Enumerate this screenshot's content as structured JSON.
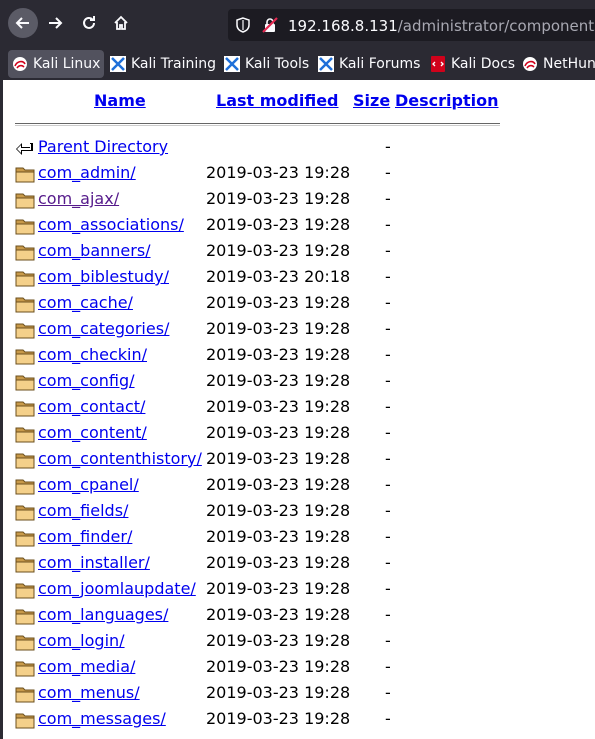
{
  "browser": {
    "url_host": "192.168.8.131",
    "url_path": "/administrator/components/",
    "bookmarks": [
      {
        "label": "Kali Linux",
        "icon": "kali-dragon-icon"
      },
      {
        "label": "Kali Training",
        "icon": "kali-training-icon"
      },
      {
        "label": "Kali Tools",
        "icon": "kali-tools-icon"
      },
      {
        "label": "Kali Forums",
        "icon": "kali-forums-icon"
      },
      {
        "label": "Kali Docs",
        "icon": "kali-docs-icon"
      },
      {
        "label": "NetHunter",
        "icon": "nethunter-icon"
      }
    ]
  },
  "listing": {
    "headers": {
      "name": "Name",
      "modified": "Last modified",
      "size": "Size",
      "description": "Description"
    },
    "parent": {
      "label": "Parent Directory",
      "size": "-"
    },
    "rows": [
      {
        "name": "com_admin/",
        "modified": "2019-03-23 19:28",
        "size": "-"
      },
      {
        "name": "com_ajax/",
        "modified": "2019-03-23 19:28",
        "size": "-"
      },
      {
        "name": "com_associations/",
        "modified": "2019-03-23 19:28",
        "size": "-"
      },
      {
        "name": "com_banners/",
        "modified": "2019-03-23 19:28",
        "size": "-"
      },
      {
        "name": "com_biblestudy/",
        "modified": "2019-03-23 20:18",
        "size": "-"
      },
      {
        "name": "com_cache/",
        "modified": "2019-03-23 19:28",
        "size": "-"
      },
      {
        "name": "com_categories/",
        "modified": "2019-03-23 19:28",
        "size": "-"
      },
      {
        "name": "com_checkin/",
        "modified": "2019-03-23 19:28",
        "size": "-"
      },
      {
        "name": "com_config/",
        "modified": "2019-03-23 19:28",
        "size": "-"
      },
      {
        "name": "com_contact/",
        "modified": "2019-03-23 19:28",
        "size": "-"
      },
      {
        "name": "com_content/",
        "modified": "2019-03-23 19:28",
        "size": "-"
      },
      {
        "name": "com_contenthistory/",
        "modified": "2019-03-23 19:28",
        "size": "-"
      },
      {
        "name": "com_cpanel/",
        "modified": "2019-03-23 19:28",
        "size": "-"
      },
      {
        "name": "com_fields/",
        "modified": "2019-03-23 19:28",
        "size": "-"
      },
      {
        "name": "com_finder/",
        "modified": "2019-03-23 19:28",
        "size": "-"
      },
      {
        "name": "com_installer/",
        "modified": "2019-03-23 19:28",
        "size": "-"
      },
      {
        "name": "com_joomlaupdate/",
        "modified": "2019-03-23 19:28",
        "size": "-"
      },
      {
        "name": "com_languages/",
        "modified": "2019-03-23 19:28",
        "size": "-"
      },
      {
        "name": "com_login/",
        "modified": "2019-03-23 19:28",
        "size": "-"
      },
      {
        "name": "com_media/",
        "modified": "2019-03-23 19:28",
        "size": "-"
      },
      {
        "name": "com_menus/",
        "modified": "2019-03-23 19:28",
        "size": "-"
      },
      {
        "name": "com_messages/",
        "modified": "2019-03-23 19:28",
        "size": "-"
      }
    ]
  }
}
